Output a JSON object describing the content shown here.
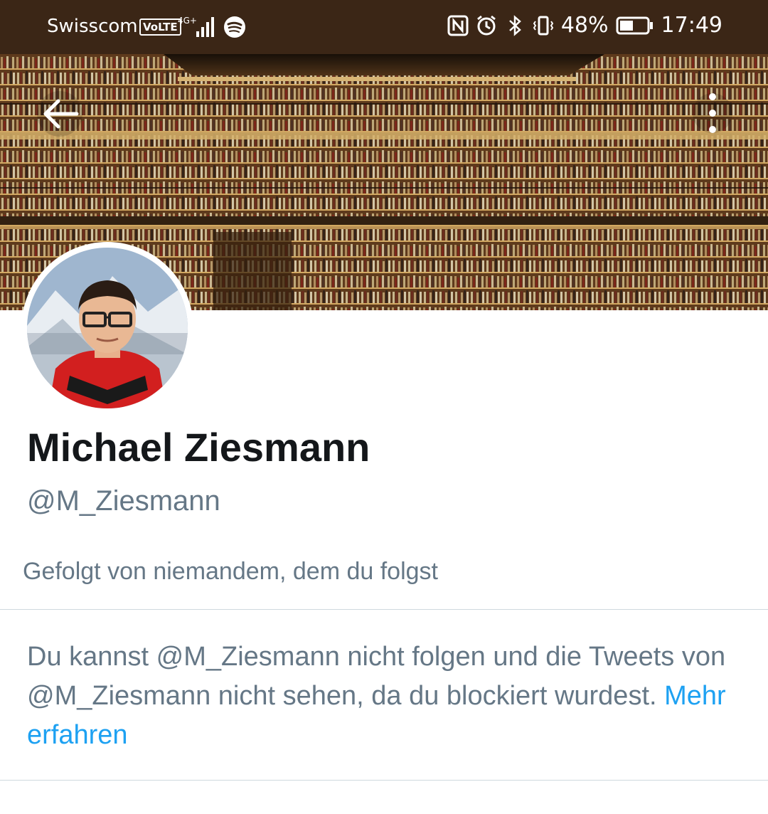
{
  "status_bar": {
    "carrier": "Swisscom",
    "volte": "VoLTE",
    "network": "4G+",
    "battery": "48%",
    "time": "17:49",
    "icons": [
      "spotify-icon",
      "nfc-icon",
      "alarm-icon",
      "bluetooth-icon",
      "vibrate-icon",
      "battery-icon"
    ]
  },
  "profile": {
    "name": "Michael Ziesmann",
    "handle": "@M_Ziesmann",
    "followed_by": "Gefolgt von niemandem, dem du folgst",
    "blocked_message": "Du kannst @M_Ziesmann nicht folgen und die Tweets von @M_Ziesmann nicht sehen, da du blockiert wurdest.",
    "learn_more": "Mehr erfahren"
  },
  "colors": {
    "link": "#1da1f2",
    "secondary_text": "#657786",
    "status_bar_bg": "#3b2616"
  }
}
